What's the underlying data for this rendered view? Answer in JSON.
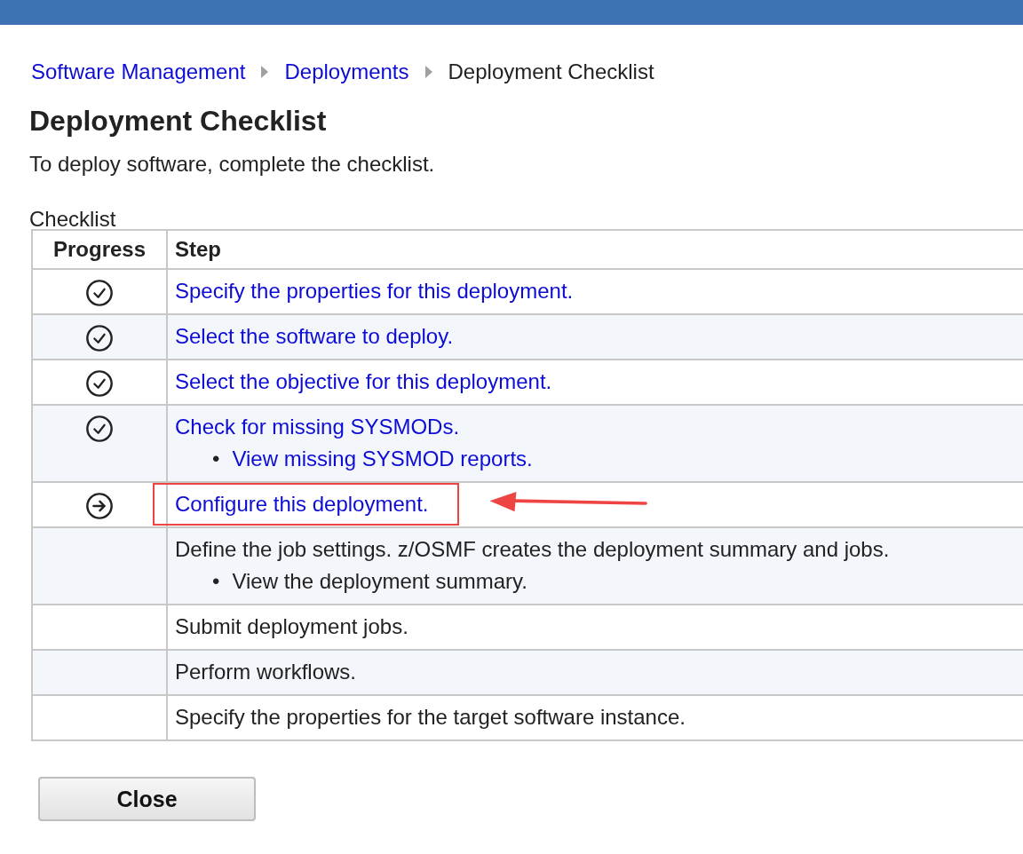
{
  "breadcrumb": [
    {
      "label": "Software Management",
      "link": true
    },
    {
      "label": "Deployments",
      "link": true
    },
    {
      "label": "Deployment Checklist",
      "link": false
    }
  ],
  "title": "Deployment Checklist",
  "description": "To deploy software, complete the checklist.",
  "table": {
    "caption": "Checklist",
    "columns": [
      "Progress",
      "Step"
    ],
    "rows": [
      {
        "kind": "completed",
        "step": "Specify the properties for this deployment.",
        "link": true,
        "highlighted": false
      },
      {
        "kind": "completed",
        "step": "Select the software to deploy.",
        "link": true,
        "highlighted": false
      },
      {
        "kind": "completed",
        "step": "Select the objective for this deployment.",
        "link": true,
        "highlighted": false
      },
      {
        "kind": "completed",
        "step": "Check for missing SYSMODs.",
        "link": true,
        "highlighted": false,
        "subitems": [
          {
            "bullet": "•",
            "label": "View missing SYSMOD reports.",
            "link": true
          }
        ]
      },
      {
        "kind": "current",
        "step": "Configure this deployment.",
        "link": true,
        "highlighted": true
      },
      {
        "kind": "pending",
        "step": "Define the job settings. z/OSMF creates the deployment summary and jobs.",
        "link": false,
        "highlighted": false,
        "subitems": [
          {
            "bullet": "•",
            "label": "View the deployment summary.",
            "link": false
          }
        ]
      },
      {
        "kind": "pending",
        "step": "Submit deployment jobs.",
        "link": false,
        "highlighted": false
      },
      {
        "kind": "pending",
        "step": "Perform workflows.",
        "link": false,
        "highlighted": false
      },
      {
        "kind": "pending",
        "step": "Specify the properties for the target software instance.",
        "link": false,
        "highlighted": false
      }
    ]
  },
  "buttons": [
    "Close"
  ]
}
